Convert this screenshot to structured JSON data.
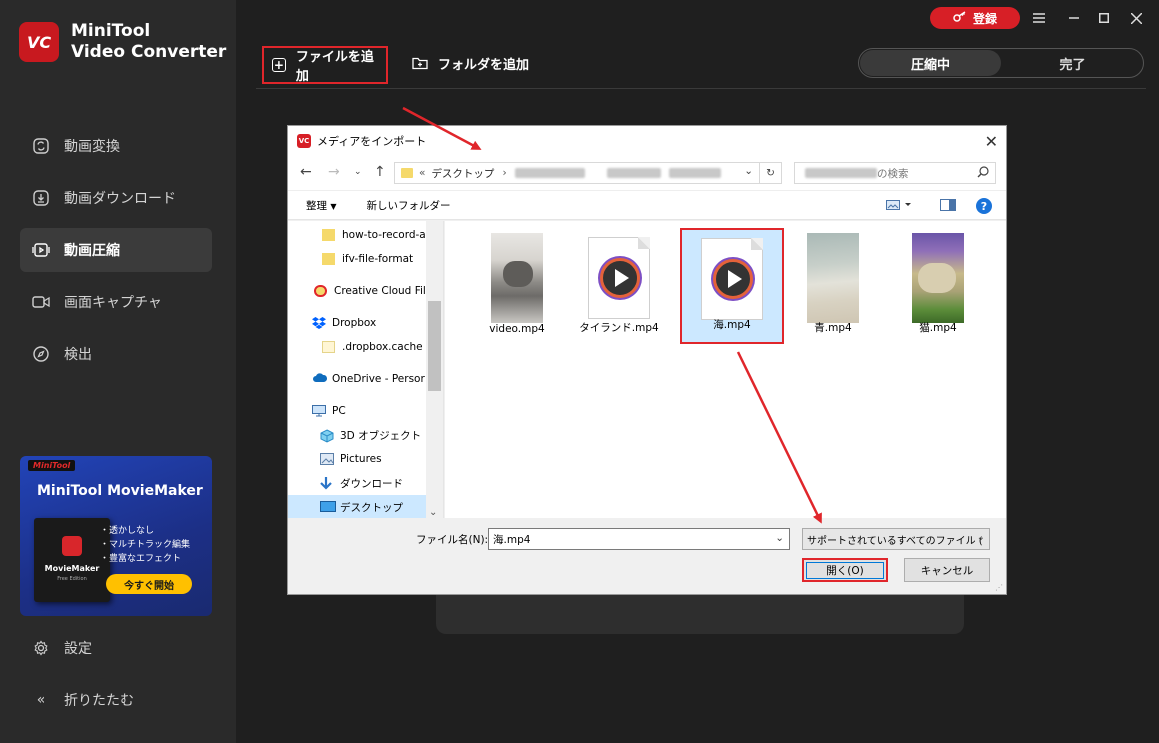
{
  "app": {
    "brand_line1": "MiniTool",
    "brand_line2": "Video Converter",
    "logo_text": "VC"
  },
  "sidebar": {
    "items": [
      {
        "label": "動画変換",
        "icon": "convert-icon"
      },
      {
        "label": "動画ダウンロード",
        "icon": "download-icon"
      },
      {
        "label": "動画圧縮",
        "icon": "compress-icon",
        "active": true
      },
      {
        "label": "画面キャプチャ",
        "icon": "camera-icon"
      },
      {
        "label": "検出",
        "icon": "compass-icon"
      }
    ],
    "bottom": [
      {
        "label": "設定",
        "icon": "gear-icon"
      },
      {
        "label": "折りたたむ",
        "icon": "collapse-icon"
      }
    ]
  },
  "promo": {
    "badge_brand": "MiniTool",
    "title": "MiniTool MovieMaker",
    "box_label": "MovieMaker",
    "box_sub": "Free Edition",
    "features": [
      "・透かしなし",
      "・マルチトラック編集",
      "・豊富なエフェクト"
    ],
    "cta": "今すぐ開始"
  },
  "topbar": {
    "login": "登録",
    "add_file": "ファイルを追加",
    "add_folder": "フォルダを追加",
    "tabs": [
      "圧縮中",
      "完了"
    ],
    "active_tab": 0
  },
  "dialog": {
    "title": "メディアをインポート",
    "logo_text": "VC",
    "breadcrumb_prefix": "«",
    "breadcrumb": "デスクトップ",
    "breadcrumb_sep": "›",
    "search_suffix": "の検索",
    "toolbar": {
      "organize": "整理",
      "new_folder": "新しいフォルダー"
    },
    "tree": [
      {
        "label": "how-to-record-a",
        "icon": "folder-icon"
      },
      {
        "label": "ifv-file-format",
        "icon": "folder-icon"
      },
      {
        "label": "Creative Cloud File",
        "icon": "creative-cloud-icon"
      },
      {
        "label": "Dropbox",
        "icon": "dropbox-icon"
      },
      {
        "label": ".dropbox.cache",
        "icon": "folder-icon"
      },
      {
        "label": "OneDrive - Persor",
        "icon": "onedrive-icon"
      },
      {
        "label": "PC",
        "icon": "pc-icon"
      },
      {
        "label": "3D オブジェクト",
        "icon": "cube-icon"
      },
      {
        "label": "Pictures",
        "icon": "pictures-icon"
      },
      {
        "label": "ダウンロード",
        "icon": "download-arrow-icon"
      },
      {
        "label": "デスクトップ",
        "icon": "desktop-icon",
        "selected": true
      }
    ],
    "files": [
      {
        "label": "video.mp4",
        "kind": "photo-cat"
      },
      {
        "label": "タイランド.mp4",
        "kind": "play"
      },
      {
        "label": "海.mp4",
        "kind": "play",
        "selected": true
      },
      {
        "label": "青.mp4",
        "kind": "photo-sea"
      },
      {
        "label": "猫.mp4",
        "kind": "photo-cats"
      }
    ],
    "filename_label": "ファイル名(N):",
    "filename_value": "海.mp4",
    "filetype": "サポートされているすべてのファイル (",
    "open": "開く(O)",
    "cancel": "キャンセル"
  },
  "colors": {
    "accent": "#e0262b",
    "sidebar_bg": "#2a2a2a",
    "main_bg": "#1f1f1f",
    "selection": "#cce8ff"
  }
}
